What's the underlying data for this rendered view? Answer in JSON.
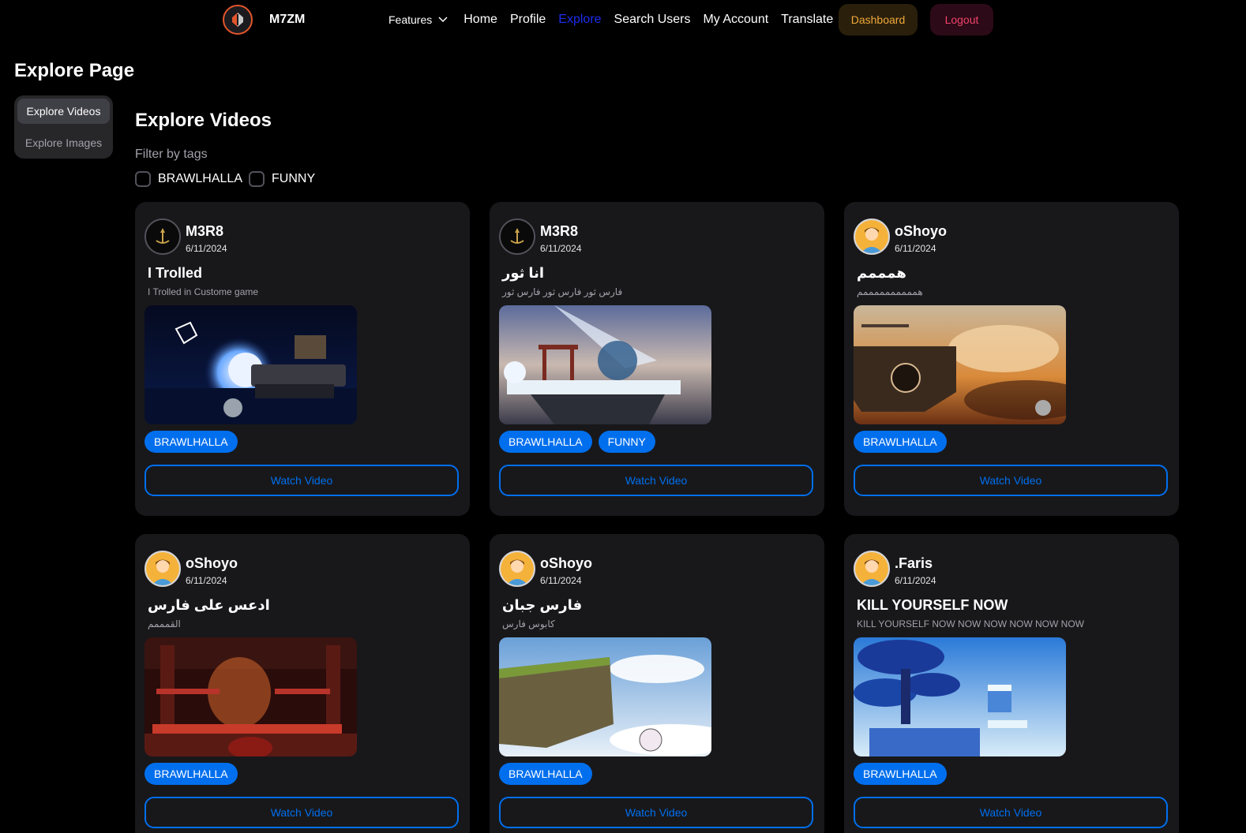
{
  "nav": {
    "brand": "M7ZM",
    "features": "Features",
    "links": [
      "Home",
      "Profile",
      "Explore",
      "Search Users",
      "My Account",
      "Translate"
    ],
    "active": "Explore",
    "dashboard": "Dashboard",
    "logout": "Logout"
  },
  "page": {
    "title": "Explore Page"
  },
  "sidebar": {
    "items": [
      "Explore Videos",
      "Explore Images"
    ],
    "selected": "Explore Videos"
  },
  "section": {
    "title": "Explore Videos",
    "filter_label": "Filter by tags",
    "tags": [
      "BRAWLHALLA",
      "FUNNY"
    ]
  },
  "cards": [
    {
      "user": "M3R8",
      "date": "6/11/2024",
      "title": "I Trolled",
      "desc": "I Trolled in Custome game",
      "tags": [
        "BRAWLHALLA"
      ],
      "button": "Watch Video",
      "avatar": "emblem-icon",
      "scene": "night"
    },
    {
      "user": "M3R8",
      "date": "6/11/2024",
      "title": "انا ثور",
      "desc": "فارس ثور فارس ثور فارس ثور",
      "tags": [
        "BRAWLHALLA",
        "FUNNY"
      ],
      "button": "Watch Video",
      "avatar": "emblem-icon",
      "scene": "temple"
    },
    {
      "user": "oShoyo",
      "date": "6/11/2024",
      "title": "همممم",
      "desc": "هممممممممممم",
      "tags": [
        "BRAWLHALLA"
      ],
      "button": "Watch Video",
      "avatar": "person-icon",
      "scene": "sunset"
    },
    {
      "user": "oShoyo",
      "date": "6/11/2024",
      "title": "ادعس على فارس",
      "desc": "القمممم",
      "tags": [
        "BRAWLHALLA"
      ],
      "button": "Watch Video",
      "avatar": "person-icon",
      "scene": "dojo"
    },
    {
      "user": "oShoyo",
      "date": "6/11/2024",
      "title": "فارس جبان",
      "desc": "كابوس فارس",
      "tags": [
        "BRAWLHALLA"
      ],
      "button": "Watch Video",
      "avatar": "person-icon",
      "scene": "sky"
    },
    {
      "user": ".Faris",
      "date": "6/11/2024",
      "title": "KILL YOURSELF NOW",
      "desc": "KILL YOURSELF NOW NOW NOW NOW NOW NOW",
      "tags": [
        "BRAWLHALLA"
      ],
      "button": "Watch Video",
      "avatar": "person-icon",
      "scene": "tree"
    }
  ],
  "colors": {
    "accent": "#006fee",
    "active_link": "#1d2cf0",
    "dashboard": "#f0a93a",
    "logout": "#f0436b"
  }
}
